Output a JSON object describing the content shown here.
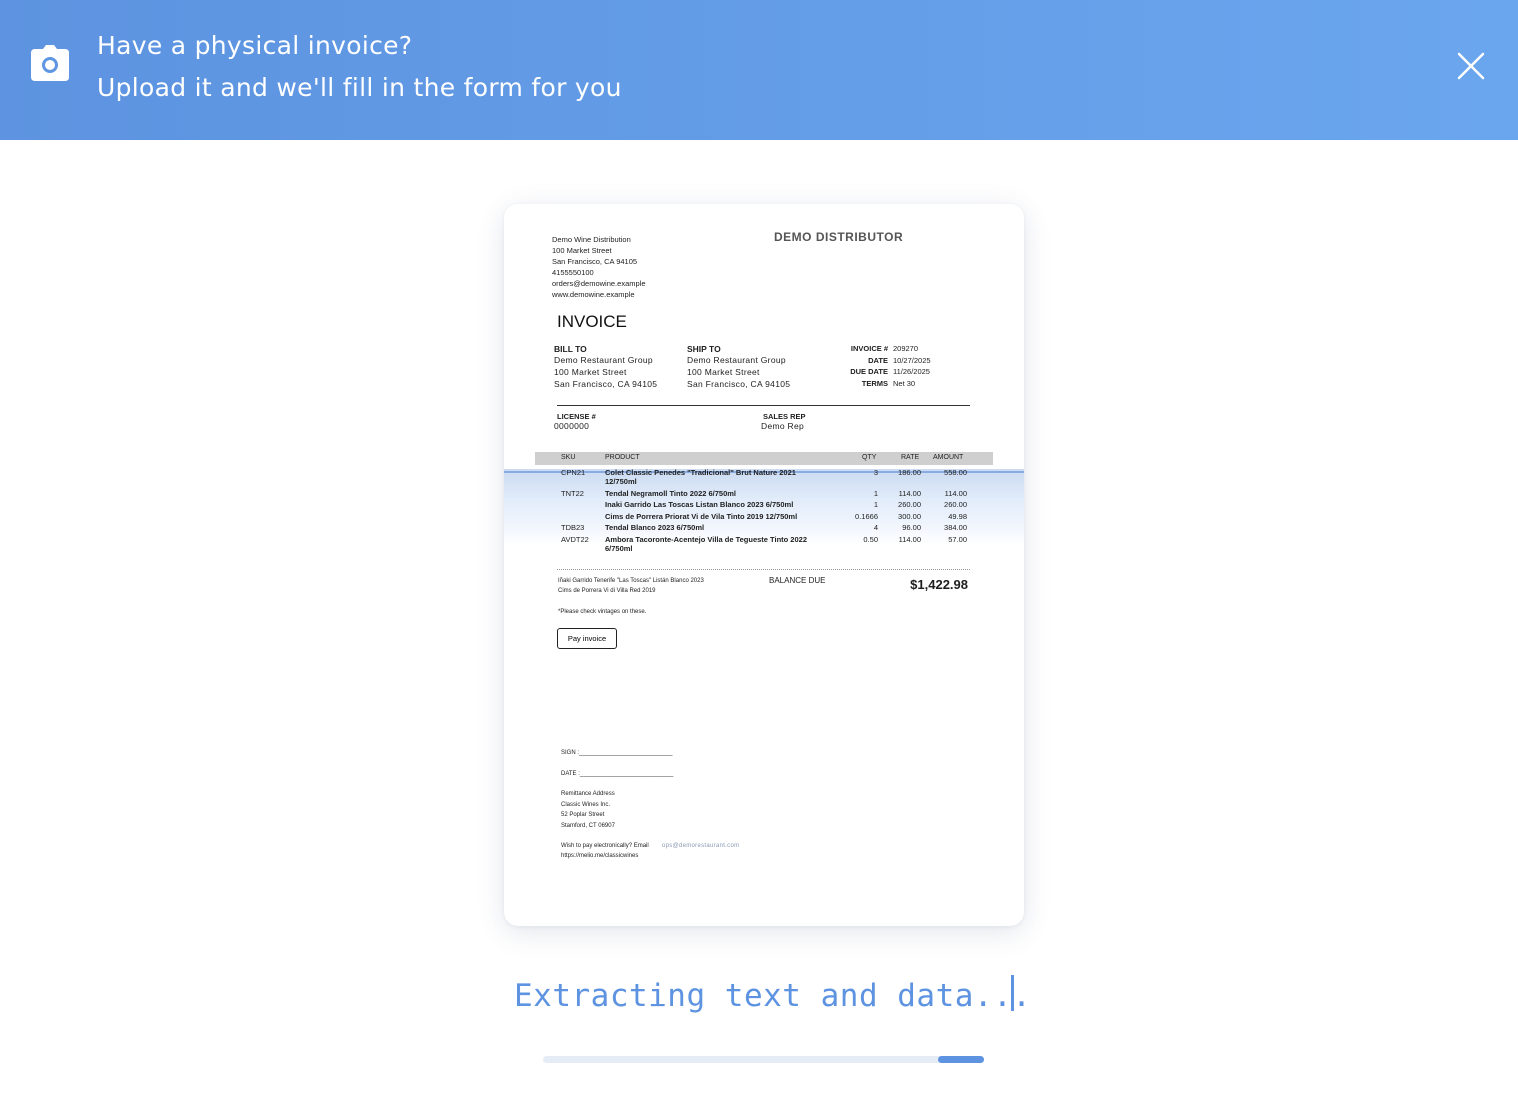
{
  "banner": {
    "title": "Have a physical invoice?",
    "subtitle": "Upload it and we'll fill in the form for you",
    "accent": "#5d93e0"
  },
  "invoice": {
    "from": {
      "name": "Demo Wine Distribution",
      "street": "100 Market Street",
      "city": "San Francisco, CA 94105",
      "phone": "4155550100",
      "email": "orders@demowine.example",
      "website": "www.demowine.example"
    },
    "brand": "DEMO DISTRIBUTOR",
    "title": "INVOICE",
    "bill_to": {
      "label": "BILL TO",
      "name": "Demo Restaurant Group",
      "street": "100 Market Street",
      "city": "San Francisco, CA  94105"
    },
    "ship_to": {
      "label": "SHIP TO",
      "name": "Demo Restaurant Group",
      "street": "100 Market Street",
      "city": "San Francisco, CA  94105"
    },
    "meta": {
      "invoice_label": "INVOICE #",
      "invoice_number": "209270",
      "date_label": "DATE",
      "date": "10/27/2025",
      "due_label": "DUE DATE",
      "due_date": "11/26/2025",
      "terms_label": "TERMS",
      "terms": "Net 30"
    },
    "license": {
      "label": "LICENSE #",
      "value": "0000000"
    },
    "sales_rep": {
      "label": "SALES REP",
      "value": "Demo Rep"
    },
    "columns": {
      "sku": "SKU",
      "product": "PRODUCT",
      "qty": "QTY",
      "rate": "RATE",
      "amount": "AMOUNT"
    },
    "lines": [
      {
        "sku": "CPN21",
        "product": "Colet Classic Penedes \"Tradicional\" Brut Nature 2021",
        "product2": "12/750ml",
        "qty": "3",
        "rate": "186.00",
        "amount": "558.00"
      },
      {
        "sku": "TNT22",
        "product": "Tendal Negramoll Tinto 2022 6/750ml",
        "product2": "",
        "qty": "1",
        "rate": "114.00",
        "amount": "114.00"
      },
      {
        "sku": "",
        "product": "Inaki Garrido Las Toscas Listan Blanco 2023 6/750ml",
        "product2": "",
        "qty": "1",
        "rate": "260.00",
        "amount": "260.00"
      },
      {
        "sku": "",
        "product": "Cims de Porrera Priorat Vi de Vila Tinto 2019 12/750ml",
        "product2": "",
        "qty": "0.1666",
        "rate": "300.00",
        "amount": "49.98"
      },
      {
        "sku": "TDB23",
        "product": "Tendal Blanco 2023 6/750ml",
        "product2": "",
        "qty": "4",
        "rate": "96.00",
        "amount": "384.00"
      },
      {
        "sku": "AVDT22",
        "product": "Ambora Tacoronte-Acentejo Villa de Tegueste Tinto 2022",
        "product2": "6/750ml",
        "qty": "0.50",
        "rate": "114.00",
        "amount": "57.00"
      }
    ],
    "notes": {
      "line1": "Iñaki Garrido Tenerife \"Las Toscas\" Listán Blanco 2023",
      "line2": "Cims de Porrera Vi di Villa Red 2019",
      "line3": "*Please check vintages on these."
    },
    "balance_label": "BALANCE DUE",
    "balance_amount": "$1,422.98",
    "pay_button": "Pay invoice",
    "sign_label": "SIGN :____________________________",
    "date_line_label": "DATE :____________________________",
    "remittance": {
      "title": "Remittance Address",
      "name": "Classic Wines Inc.",
      "street": "52 Poplar Street",
      "city": "Stamford, CT 06907"
    },
    "electronic": {
      "text": "Wish to pay electronically? Email",
      "email": "ops@demorestaurant.com",
      "url": "https://melio.me/classicwines"
    }
  },
  "status": {
    "text": "Extracting text and data...",
    "progress": 0.1
  }
}
